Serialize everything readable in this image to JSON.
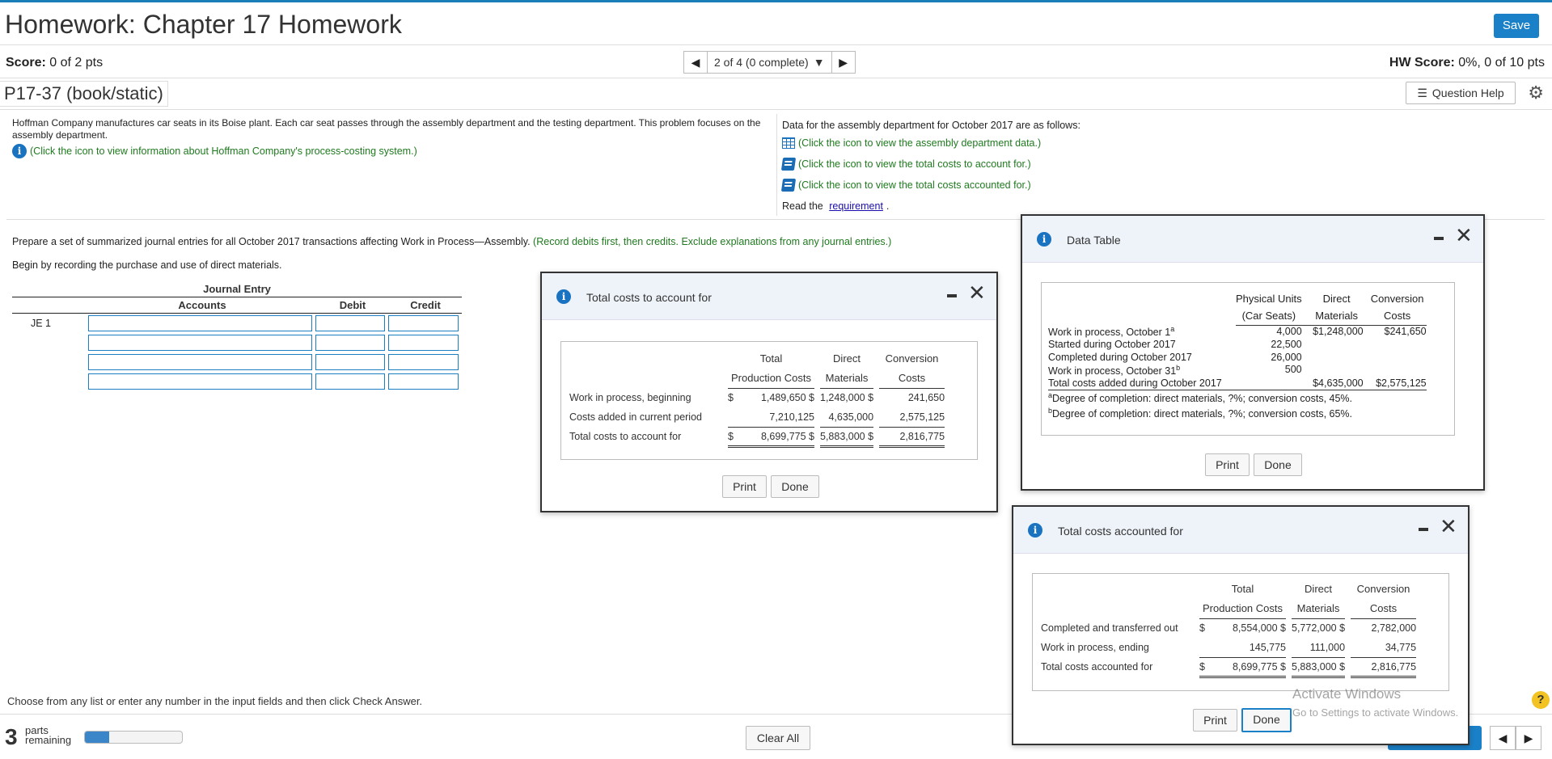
{
  "header": {
    "title": "Homework: Chapter 17 Homework",
    "save_label": "Save"
  },
  "scorebar": {
    "score_label": "Score:",
    "score_value": " 0 of 2 pts",
    "nav_text": "2 of 4 (0 complete)",
    "hw_label": "HW Score:",
    "hw_value": " 0%, 0 of 10 pts"
  },
  "problem": {
    "id": "P17-37 (book/static)",
    "question_help": "Question Help"
  },
  "intro": {
    "text": "Hoffman Company manufactures car seats in its Boise plant. Each car seat passes through the assembly department and the testing department. This problem focuses on the assembly department.",
    "info_link": "(Click the icon to view information about Hoffman Company's process-costing system.)"
  },
  "data_links": {
    "heading": "Data for the assembly department for October 2017 are as follows:",
    "link1": "(Click the icon to view the assembly department data.)",
    "link2": "(Click the icon to view the total costs to account for.)",
    "link3": "(Click the icon to view the total costs accounted for.)",
    "read_prefix": "Read the ",
    "requirement": "requirement",
    "read_suffix": "."
  },
  "instructions": {
    "prepare": "Prepare a set of summarized journal entries for all October 2017 transactions affecting Work in Process—Assembly.",
    "prepare_note": " (Record debits first, then credits. Exclude explanations from any journal entries.)",
    "begin": "Begin by recording the purchase and use of direct materials."
  },
  "journal": {
    "title": "Journal Entry",
    "col_accounts": "Accounts",
    "col_debit": "Debit",
    "col_credit": "Credit",
    "entry_label": "JE 1"
  },
  "footer": {
    "choose": "Choose from any list or enter any number in the input fields and then click Check Answer.",
    "parts_num": "3",
    "parts_line1": "parts",
    "parts_line2": "remaining",
    "progress_fraction": 0.25,
    "clear_all": "Clear All"
  },
  "modal_tca": {
    "title": "Total costs to account for",
    "h_total1": "Total",
    "h_total2": "Production Costs",
    "h_dm1": "Direct",
    "h_dm2": "Materials",
    "h_cc1": "Conversion",
    "h_cc2": "Costs",
    "r1_label": "Work in process, beginning",
    "r1_sym": "$",
    "r1_total": "1,489,650 $",
    "r1_dm": "1,248,000 $",
    "r1_cc": "241,650",
    "r2_label": "Costs added in current period",
    "r2_total": "7,210,125",
    "r2_dm": "4,635,000",
    "r2_cc": "2,575,125",
    "r3_label": "Total costs to account for",
    "r3_sym": "$",
    "r3_total": "8,699,775 $",
    "r3_dm": "5,883,000 $",
    "r3_cc": "2,816,775",
    "print": "Print",
    "done": "Done"
  },
  "modal_dt": {
    "title": "Data Table",
    "h_pu1": "Physical Units",
    "h_pu2": "(Car Seats)",
    "h_dm1": "Direct",
    "h_dm2": "Materials",
    "h_cc1": "Conversion",
    "h_cc2": "Costs",
    "r1_label": "Work in process, October 1",
    "r1_sup": "a",
    "r1_pu": "4,000",
    "r1_dm": "$1,248,000",
    "r1_cc": "$241,650",
    "r2_label": "Started during October 2017",
    "r2_pu": "22,500",
    "r3_label": "Completed during October 2017",
    "r3_pu": "26,000",
    "r4_label": "Work in process, October 31",
    "r4_sup": "b",
    "r4_pu": "500",
    "r5_label": "Total costs added during October 2017",
    "r5_dm": "$4,635,000",
    "r5_cc": "$2,575,125",
    "note_a_sup": "a",
    "note_a": "Degree of completion: direct materials, ?%; conversion costs, 45%.",
    "note_b_sup": "b",
    "note_b": "Degree of completion: direct materials, ?%; conversion costs, 65%.",
    "print": "Print",
    "done": "Done"
  },
  "modal_tcaf": {
    "title": "Total costs accounted for",
    "h_total1": "Total",
    "h_total2": "Production Costs",
    "h_dm1": "Direct",
    "h_dm2": "Materials",
    "h_cc1": "Conversion",
    "h_cc2": "Costs",
    "r1_label": "Completed and transferred out",
    "r1_sym": "$",
    "r1_total": "8,554,000 $",
    "r1_dm": "5,772,000 $",
    "r1_cc": "2,782,000",
    "r2_label": "Work in process, ending",
    "r2_total": "145,775",
    "r2_dm": "111,000",
    "r2_cc": "34,775",
    "r3_label": "Total costs accounted for",
    "r3_sym": "$",
    "r3_total": "8,699,775 $",
    "r3_dm": "5,883,000 $",
    "r3_cc": "2,816,775",
    "print": "Print",
    "done": "Done"
  },
  "watermark": {
    "line1": "Activate Windows",
    "line2": "Go to Settings to activate Windows."
  },
  "colors": {
    "accent": "#1a80c8",
    "link_green": "#1f7a1f",
    "modal_header": "#eef3fa"
  }
}
